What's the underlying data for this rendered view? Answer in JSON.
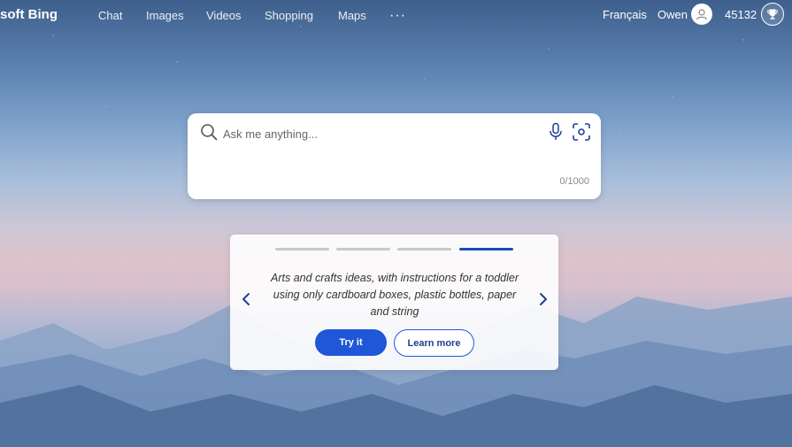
{
  "header": {
    "brand": "soft Bing",
    "nav": [
      {
        "label": "Chat"
      },
      {
        "label": "Images"
      },
      {
        "label": "Videos"
      },
      {
        "label": "Shopping"
      },
      {
        "label": "Maps"
      }
    ],
    "more_label": "···",
    "language": "Français",
    "user_name": "Owen",
    "reward_points": "45132"
  },
  "search": {
    "placeholder": "Ask me anything...",
    "counter": "0/1000"
  },
  "suggestion": {
    "pages_total": 4,
    "active_page": 4,
    "text": "Arts and crafts ideas, with instructions for a toddler using only cardboard boxes, plastic bottles, paper and string",
    "try_label": "Try it",
    "learn_label": "Learn more"
  },
  "colors": {
    "accent": "#1f57d8",
    "active_dot": "#1e4bb8"
  },
  "icons": [
    "search-icon",
    "microphone-icon",
    "visual-search-icon",
    "user-icon",
    "trophy-icon",
    "chevron-left-icon",
    "chevron-right-icon"
  ]
}
